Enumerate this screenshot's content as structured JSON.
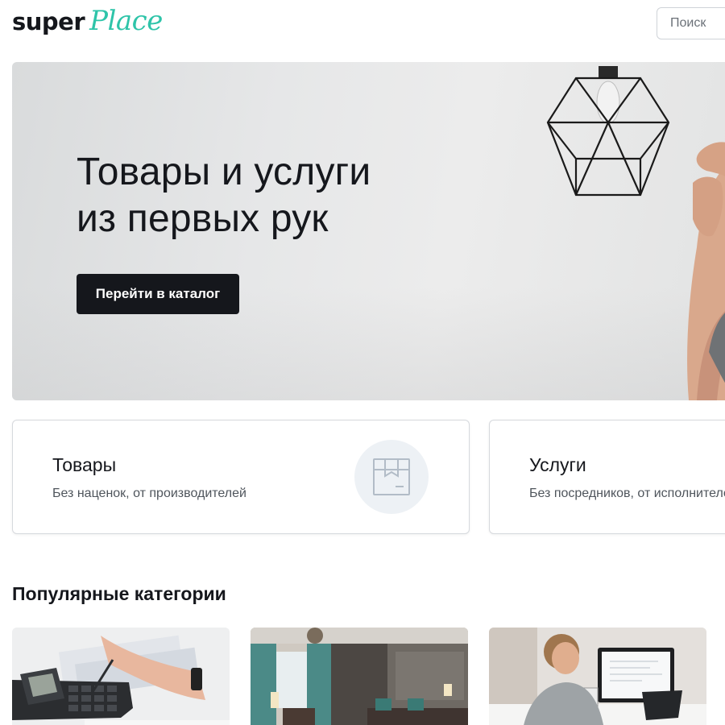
{
  "header": {
    "logo_super": "super",
    "logo_place": "Place",
    "search_placeholder": "Поиск"
  },
  "hero": {
    "title_line1": "Товары и услуги",
    "title_line2": "из первых рук",
    "cta_label": "Перейти в каталог"
  },
  "features": [
    {
      "title": "Товары",
      "subtitle": "Без наценок, от производителей",
      "icon": "box-icon"
    },
    {
      "title": "Услуги",
      "subtitle": "Без посредников, от исполнителей"
    }
  ],
  "popular": {
    "title": "Популярные категории",
    "items": [
      {
        "image": "calculator-photo"
      },
      {
        "image": "interior-photo"
      },
      {
        "image": "computer-work-photo"
      }
    ]
  },
  "colors": {
    "brand_dark": "#15171c",
    "brand_accent": "#2ec4a9",
    "icon_circle": "#edf1f5",
    "border": "#d6d9dd"
  }
}
